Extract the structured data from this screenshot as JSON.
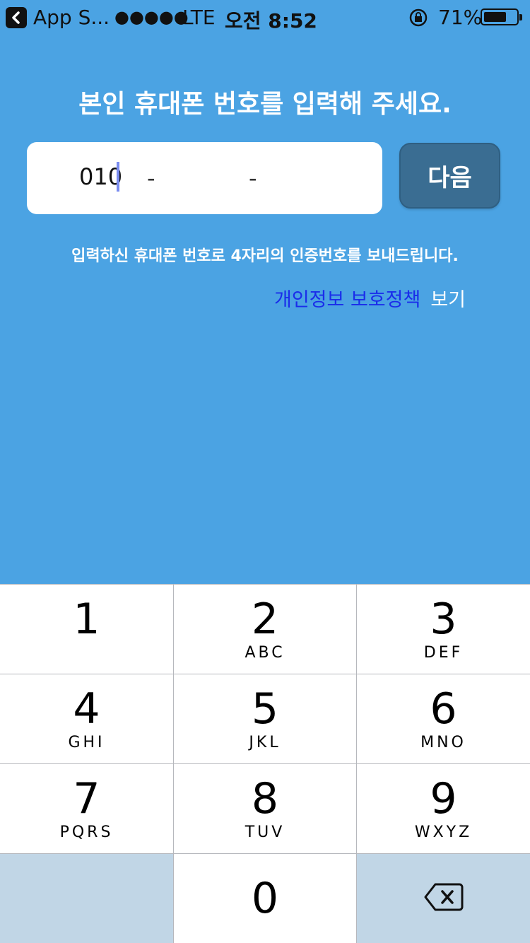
{
  "status_bar": {
    "app_back": "App S...",
    "signal": "●●●●●",
    "carrier": "LTE",
    "time": "오전 8:52",
    "battery_pct": "71%",
    "battery_level": 0.71
  },
  "title": "본인 휴대폰 번호를 입력해 주세요.",
  "phone_input": {
    "part1": "010",
    "dash1": "-",
    "dash2": "-"
  },
  "next_button_label": "다음",
  "info_text": "입력하신 휴대폰 번호로 4자리의 인증번호를 보내드립니다.",
  "privacy_link": "개인정보 보호정책",
  "privacy_view": "보기",
  "keypad": {
    "keys": [
      {
        "num": "1",
        "letters": ""
      },
      {
        "num": "2",
        "letters": "ABC"
      },
      {
        "num": "3",
        "letters": "DEF"
      },
      {
        "num": "4",
        "letters": "GHI"
      },
      {
        "num": "5",
        "letters": "JKL"
      },
      {
        "num": "6",
        "letters": "MNO"
      },
      {
        "num": "7",
        "letters": "PQRS"
      },
      {
        "num": "8",
        "letters": "TUV"
      },
      {
        "num": "9",
        "letters": "WXYZ"
      },
      {
        "num": "0",
        "letters": ""
      }
    ],
    "delete_icon": "backspace-icon"
  },
  "colors": {
    "background": "#4ba3e3",
    "button": "#3a6d92",
    "link": "#1a2dea"
  }
}
